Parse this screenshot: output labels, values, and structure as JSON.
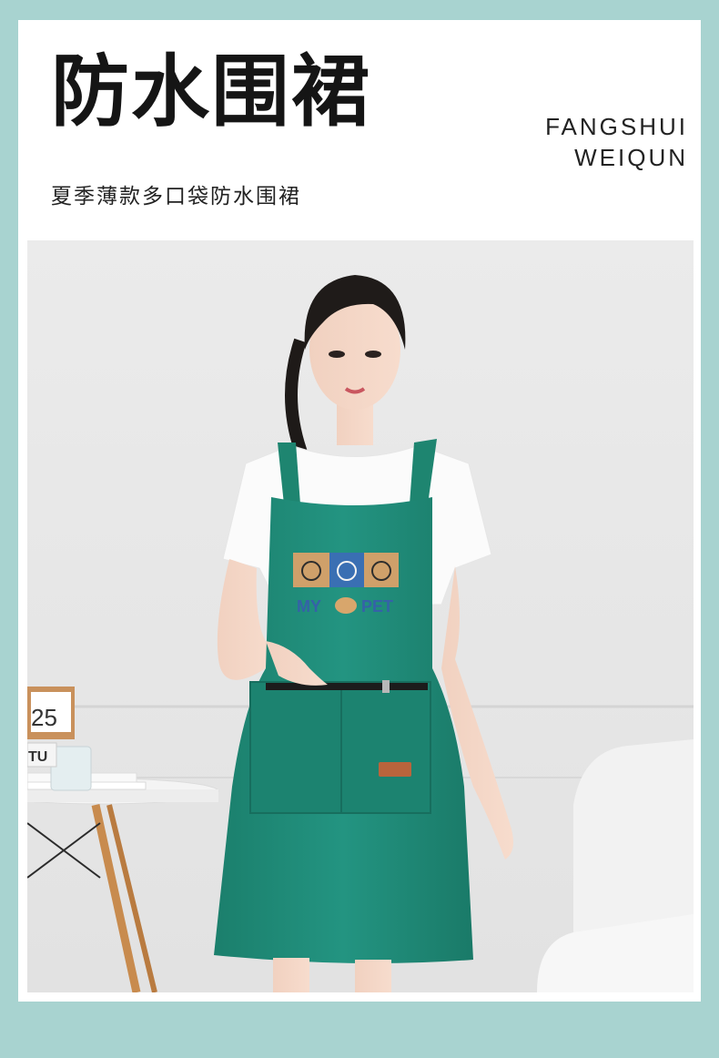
{
  "header": {
    "title": "防水围裙",
    "subtitle": "夏季薄款多口袋防水围裙",
    "pinyin_line1": "FANGSHUI",
    "pinyin_line2": "WEIQUN"
  },
  "photo": {
    "apron_print_text_left": "MY",
    "apron_print_text_right": "PET",
    "calendar_text": "25",
    "book_text": "TU"
  },
  "colors": {
    "frame": "#a8d3d0",
    "apron": "#1f8a76",
    "background_wall": "#e9e9e9"
  }
}
